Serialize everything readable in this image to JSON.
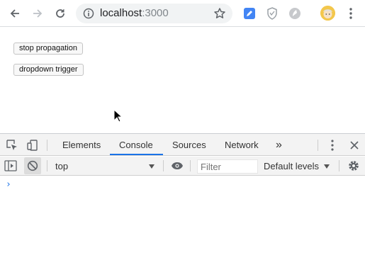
{
  "browser": {
    "url_host": "localhost",
    "url_port": ":3000"
  },
  "page": {
    "buttons": [
      {
        "label": "stop propagation"
      },
      {
        "label": "dropdown trigger"
      }
    ]
  },
  "devtools": {
    "tabs": [
      {
        "label": "Elements"
      },
      {
        "label": "Console"
      },
      {
        "label": "Sources"
      },
      {
        "label": "Network"
      },
      {
        "label": "»"
      }
    ],
    "active_tab": "Console",
    "context": "top",
    "filter_placeholder": "Filter",
    "levels": "Default levels",
    "prompt": "›"
  },
  "colors": {
    "accent": "#1a73e8"
  }
}
